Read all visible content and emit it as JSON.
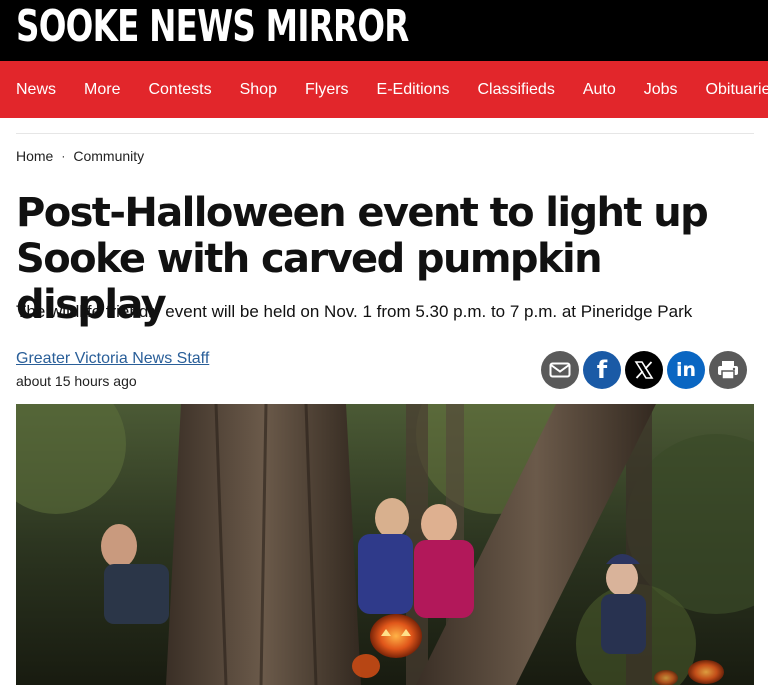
{
  "site": {
    "name": "SOOKE NEWS MIRROR"
  },
  "nav": {
    "items": [
      {
        "label": "News"
      },
      {
        "label": "More"
      },
      {
        "label": "Contests"
      },
      {
        "label": "Shop"
      },
      {
        "label": "Flyers"
      },
      {
        "label": "E-Editions"
      },
      {
        "label": "Classifieds"
      },
      {
        "label": "Auto"
      },
      {
        "label": "Jobs"
      },
      {
        "label": "Obituaries"
      }
    ]
  },
  "breadcrumb": {
    "home": "Home",
    "separator": "·",
    "section": "Community"
  },
  "article": {
    "headline": "Post-Halloween event to light up Sooke with carved pumpkin display",
    "subheadline": "The wildlife friendly event will be held on Nov. 1 from 5.30 p.m. to 7 p.m. at Pineridge Park",
    "author": "Greater Victoria News Staff",
    "timestamp": "about 15 hours ago"
  },
  "share": {
    "buttons": [
      {
        "name": "email-share",
        "icon": "envelope-icon",
        "color": "#5a5a5a"
      },
      {
        "name": "facebook-share",
        "icon": "facebook-icon",
        "color": "#1a5aa6",
        "glyph": "f"
      },
      {
        "name": "x-share",
        "icon": "x-icon",
        "color": "#000000",
        "glyph": "𝕏"
      },
      {
        "name": "linkedin-share",
        "icon": "linkedin-icon",
        "color": "#0a66c2",
        "glyph": "in"
      },
      {
        "name": "print-share",
        "icon": "printer-icon",
        "color": "#5a5a5a"
      }
    ]
  },
  "colors": {
    "masthead": "#000000",
    "nav": "#e2262b",
    "link": "#2a5f99"
  }
}
